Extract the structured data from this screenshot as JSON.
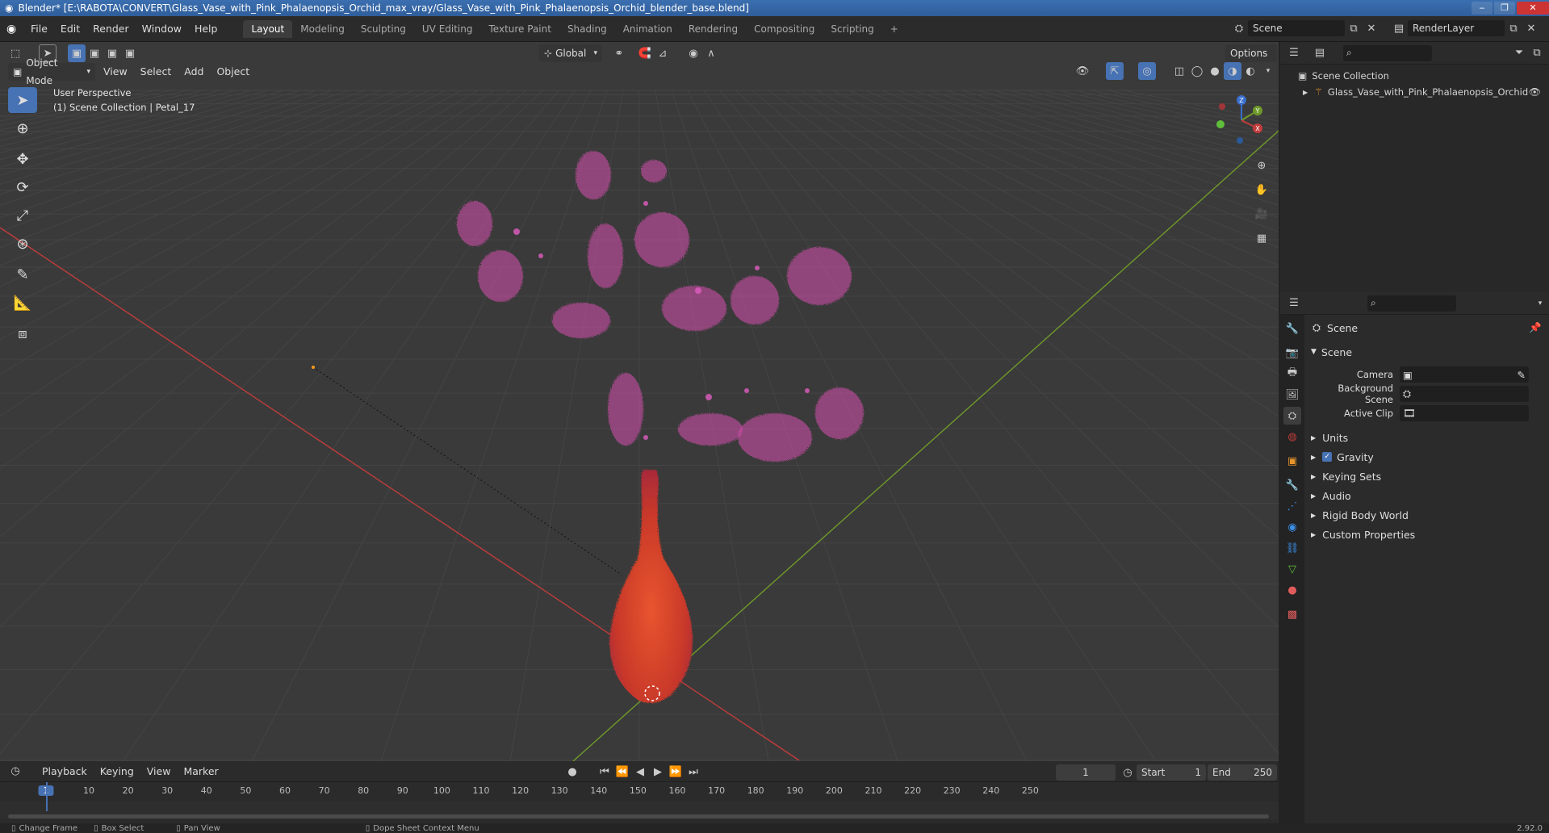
{
  "window": {
    "title": "Blender* [E:\\RABOTA\\CONVERT\\Glass_Vase_with_Pink_Phalaenopsis_Orchid_max_vray/Glass_Vase_with_Pink_Phalaenopsis_Orchid_blender_base.blend]"
  },
  "menu": {
    "items": [
      "File",
      "Edit",
      "Render",
      "Window",
      "Help"
    ]
  },
  "workspaces": [
    "Layout",
    "Modeling",
    "Sculpting",
    "UV Editing",
    "Texture Paint",
    "Shading",
    "Animation",
    "Rendering",
    "Compositing",
    "Scripting",
    "+"
  ],
  "top_right": {
    "scene": "Scene",
    "render_layer": "RenderLayer"
  },
  "viewport_header": {
    "transform_orientation": "Global",
    "options": "Options",
    "mode": "Object Mode",
    "menus": [
      "View",
      "Select",
      "Add",
      "Object"
    ]
  },
  "viewport_info": {
    "line1": "User Perspective",
    "line2": "(1) Scene Collection | Petal_17"
  },
  "gizmo": {
    "x": "X",
    "y": "Y",
    "z": "Z"
  },
  "outliner": {
    "root": "Scene Collection",
    "items": [
      "Glass_Vase_with_Pink_Phalaenopsis_Orchid"
    ]
  },
  "properties": {
    "context": "Scene",
    "panel": "Scene",
    "fields": [
      {
        "label": "Camera",
        "value": ""
      },
      {
        "label": "Background Scene",
        "value": ""
      },
      {
        "label": "Active Clip",
        "value": ""
      }
    ],
    "subpanels": [
      "Units",
      "Gravity",
      "Keying Sets",
      "Audio",
      "Rigid Body World",
      "Custom Properties"
    ],
    "gravity_checked": true
  },
  "timeline": {
    "menus": [
      "Playback",
      "Keying",
      "View",
      "Marker"
    ],
    "current_frame": "1",
    "start_label": "Start",
    "start": "1",
    "end_label": "End",
    "end": "250",
    "ticks": [
      "1",
      "10",
      "20",
      "30",
      "40",
      "50",
      "60",
      "70",
      "80",
      "90",
      "100",
      "110",
      "120",
      "130",
      "140",
      "150",
      "160",
      "170",
      "180",
      "190",
      "200",
      "210",
      "220",
      "230",
      "240",
      "250"
    ]
  },
  "statusbar": {
    "items": [
      "Change Frame",
      "Box Select",
      "Pan View",
      "Dope Sheet Context Menu"
    ],
    "version": "2.92.0"
  },
  "colors": {
    "accent": "#4772b3",
    "x_axis": "#c23c3c",
    "y_axis": "#6f9a2a",
    "orchid": "#d84fb0",
    "vase": "#d6452a"
  }
}
